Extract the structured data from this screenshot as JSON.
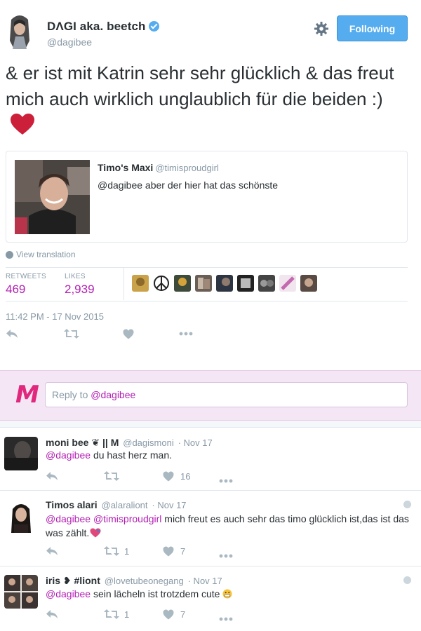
{
  "tweet": {
    "author_name": "DΛGI aka. beetch",
    "handle": "@dagibee",
    "follow_label": "Following",
    "text": "& er ist mit Katrin sehr sehr glücklich & das freut mich auch wirklich unglaublich für die beiden :)",
    "quote": {
      "author_name": "Timo's Maxi",
      "handle": "@timisproudgirl",
      "text": "@dagibee aber der hier hat das schönste"
    },
    "view_translation": "View translation",
    "retweets_label": "RETWEETS",
    "retweets": "469",
    "likes_label": "LIKES",
    "likes": "2,939",
    "timestamp": "11:42 PM - 17 Nov 2015"
  },
  "reply_box": {
    "prefix": "Reply to",
    "mention": "@dagibee"
  },
  "replies": [
    {
      "name": "moni bee ❦ || M",
      "handle": "@dagismoni",
      "date": "· Nov 17",
      "mention": "@dagibee",
      "text": "du hast herz man.",
      "retweets": "",
      "likes": "16"
    },
    {
      "name": "Timos alari",
      "handle": "@alaraliont",
      "date": "· Nov 17",
      "mention": "@dagibee",
      "mention2": "@timisproudgirl",
      "text": "mich freut es auch sehr das timo glücklich ist,das ist das was zählt.",
      "retweets": "1",
      "likes": "7"
    },
    {
      "name": "iris ❥ #liont",
      "handle": "@lovetubeonegang",
      "date": "· Nov 17",
      "mention": "@dagibee",
      "text": "sein lächeln ist trotzdem cute",
      "retweets": "1",
      "likes": "7"
    }
  ],
  "colors": {
    "accent": "#b31fb3",
    "follow_button": "#55acee",
    "reply_bar": "#f5e6f5",
    "heart": "#cc1f3a",
    "m_logo": "#e0287d"
  },
  "icons": [
    "verified-badge-icon",
    "gear-icon",
    "heart-icon",
    "globe-icon",
    "reply-icon",
    "retweet-icon",
    "like-icon",
    "more-icon"
  ]
}
